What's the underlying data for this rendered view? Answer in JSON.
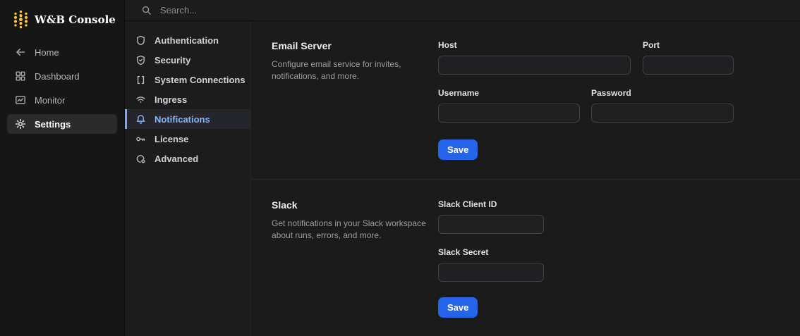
{
  "app": {
    "title": "W&B Console"
  },
  "topbar": {
    "search_placeholder": "Search..."
  },
  "sidebar": {
    "items": [
      {
        "label": "Home",
        "icon": "arrow-left",
        "active": false
      },
      {
        "label": "Dashboard",
        "icon": "dashboard-grid",
        "active": false
      },
      {
        "label": "Monitor",
        "icon": "monitor-chart",
        "active": false
      },
      {
        "label": "Settings",
        "icon": "gear",
        "active": true
      }
    ]
  },
  "settings_nav": {
    "items": [
      {
        "label": "Authentication",
        "icon": "shield",
        "active": false
      },
      {
        "label": "Security",
        "icon": "shield-check",
        "active": false
      },
      {
        "label": "System Connections",
        "icon": "brackets",
        "active": false
      },
      {
        "label": "Ingress",
        "icon": "wifi",
        "active": false
      },
      {
        "label": "Notifications",
        "icon": "bell",
        "active": true
      },
      {
        "label": "License",
        "icon": "key",
        "active": false
      },
      {
        "label": "Advanced",
        "icon": "gear-circle",
        "active": false
      }
    ]
  },
  "sections": [
    {
      "title": "Email Server",
      "description_lines": [
        "Configure email service for invites,",
        "notifications, and more."
      ],
      "fields": [
        {
          "label": "Host",
          "value": ""
        },
        {
          "label": "Port",
          "value": ""
        },
        {
          "label": "Username",
          "value": ""
        },
        {
          "label": "Password",
          "value": ""
        }
      ],
      "save_label": "Save"
    },
    {
      "title": "Slack",
      "description_lines": [
        "Get notifications in your Slack workspace",
        "about runs, errors, and more."
      ],
      "fields": [
        {
          "label": "Slack Client ID",
          "value": ""
        },
        {
          "label": "Slack Secret",
          "value": ""
        }
      ],
      "save_label": "Save"
    }
  ],
  "colors": {
    "accent_blue": "#2563eb",
    "active_nav_blue": "#8ab4f8",
    "logo_gold": "#ffc933"
  }
}
